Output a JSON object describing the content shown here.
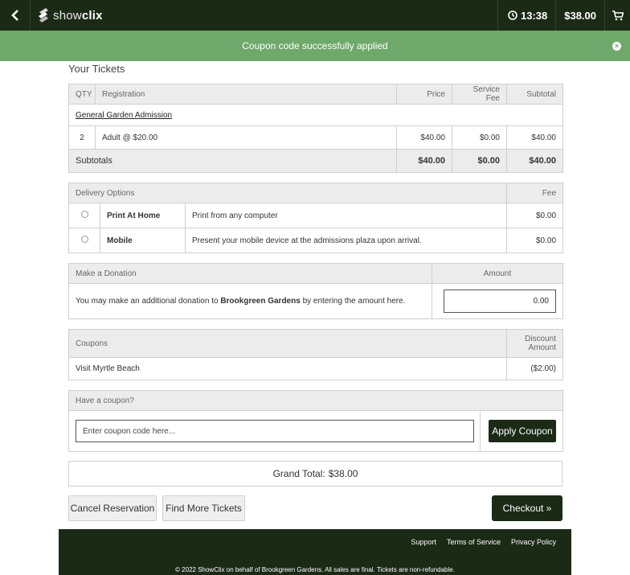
{
  "header": {
    "logo_text_a": "show",
    "logo_text_b": "clix",
    "timer": "13:38",
    "cart_total": "$38.00"
  },
  "alert": {
    "message": "Coupon code successfully applied"
  },
  "tickets": {
    "title": "Your Tickets",
    "columns": [
      "QTY",
      "Registration",
      "Price",
      "Service Fee",
      "Subtotal"
    ],
    "event_link": "General Garden Admission",
    "rows": [
      {
        "qty": "2",
        "registration": "Adult @ $20.00",
        "price": "$40.00",
        "fee": "$0.00",
        "subtotal": "$40.00"
      }
    ],
    "subtotals": {
      "label": "Subtotals",
      "price": "$40.00",
      "fee": "$0.00",
      "subtotal": "$40.00"
    }
  },
  "delivery": {
    "header": "Delivery Options",
    "fee_header": "Fee",
    "options": [
      {
        "name": "Print At Home",
        "description": "Print from any computer",
        "fee": "$0.00",
        "selected": false
      },
      {
        "name": "Mobile",
        "description": "Present your mobile device at the admissions plaza upon arrival.",
        "fee": "$0.00",
        "selected": false
      }
    ]
  },
  "donation": {
    "header": "Make a Donation",
    "amount_header": "Amount",
    "text_before": "You may make an additional donation to ",
    "org": "Brookgreen Gardens",
    "text_after": " by entering the amount here.",
    "amount_value": "0.00"
  },
  "coupons": {
    "header": "Coupons",
    "discount_header_1": "Discount",
    "discount_header_2": "Amount",
    "rows": [
      {
        "name": "Visit Myrtle Beach",
        "amount": "($2.00)"
      }
    ]
  },
  "have_coupon": {
    "header": "Have a coupon?",
    "placeholder": "Enter coupon code here...",
    "apply_label": "Apply Coupon"
  },
  "grand_total": {
    "label": "Grand Total:",
    "value": "$38.00"
  },
  "actions": {
    "cancel_label": "Cancel Reservation",
    "find_label": "Find More Tickets",
    "checkout_label": "Checkout »"
  },
  "footer": {
    "links": [
      "Support",
      "Terms of Service",
      "Privacy Policy"
    ],
    "copyright": "© 2022 ShowClix on behalf of Brookgreen Gardens. All sales are final. Tickets are non-refundable."
  },
  "colors": {
    "dark_green": "#1b2a15",
    "alert_green": "#6fa86b",
    "header_gray": "#ececec"
  }
}
